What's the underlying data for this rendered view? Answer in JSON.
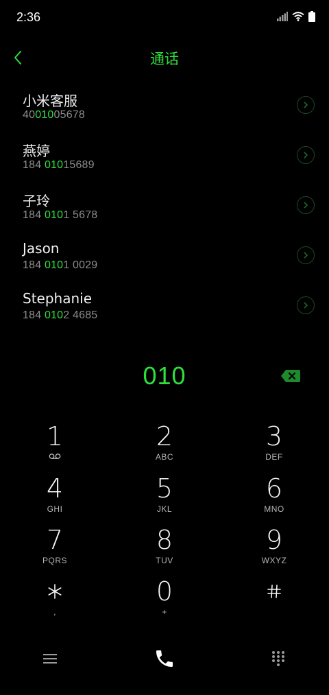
{
  "status": {
    "time": "2:36"
  },
  "header": {
    "title": "通话",
    "back_icon": "chevron-left-icon"
  },
  "contacts": [
    {
      "name": "小米客服",
      "number_parts": [
        "40",
        "010",
        "05678"
      ]
    },
    {
      "name": "燕婷",
      "number_parts": [
        "184 ",
        "010",
        "15689"
      ]
    },
    {
      "name": "子玲",
      "number_parts": [
        "184 ",
        "010",
        "1 5678"
      ]
    },
    {
      "name": "Jason",
      "number_parts": [
        "184 ",
        "010",
        "1 0029"
      ]
    },
    {
      "name": "Stephanie",
      "number_parts": [
        "184 ",
        "010",
        "2 4685"
      ]
    }
  ],
  "dialer": {
    "entered": "010"
  },
  "keypad": [
    {
      "digit": "1",
      "letters": ""
    },
    {
      "digit": "2",
      "letters": "ABC"
    },
    {
      "digit": "3",
      "letters": "DEF"
    },
    {
      "digit": "4",
      "letters": "GHI"
    },
    {
      "digit": "5",
      "letters": "JKL"
    },
    {
      "digit": "6",
      "letters": "MNO"
    },
    {
      "digit": "7",
      "letters": "PQRS"
    },
    {
      "digit": "8",
      "letters": "TUV"
    },
    {
      "digit": "9",
      "letters": "WXYZ"
    },
    {
      "digit": "*",
      "letters": ","
    },
    {
      "digit": "0",
      "letters": "+"
    },
    {
      "digit": "#",
      "letters": ""
    }
  ],
  "colors": {
    "accent": "#2ee03c",
    "background": "#000000",
    "secondary_text": "#8c8c8c"
  }
}
